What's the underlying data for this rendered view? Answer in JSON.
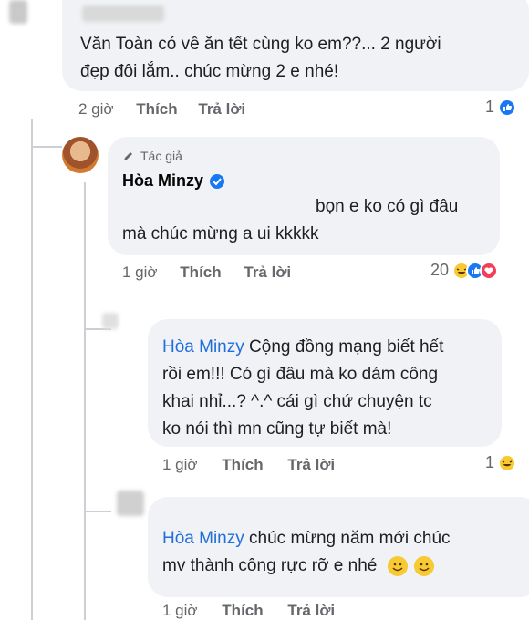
{
  "comments": [
    {
      "text_line1": "Văn Toàn có về ăn tết cùng ko em??... 2 người",
      "text_line2": "đẹp đôi lắm.. chúc mừng 2 e nhé!",
      "time": "2 giờ",
      "like": "Thích",
      "reply": "Trả lời",
      "reaction_count": "1"
    },
    {
      "author_badge": "Tác giả",
      "author": "Hòa Minzy",
      "text_line1": "bọn e ko có gì đâu",
      "text_line2": "mà chúc mừng a ui kkkkk",
      "time": "1 giờ",
      "like": "Thích",
      "reply": "Trả lời",
      "reaction_count": "20"
    },
    {
      "mention": "Hòa Minzy",
      "text_line1": " Cộng đồng mạng biết hết",
      "text_line2": "rồi em!!! Có gì đâu mà ko dám công",
      "text_line3": "khai nhỉ...? ^.^ cái gì chứ chuyện tc",
      "text_line4": "ko nói thì mn cũng tự biết mà!",
      "time": "1 giờ",
      "like": "Thích",
      "reply": "Trả lời",
      "reaction_count": "1"
    },
    {
      "mention": "Hòa Minzy",
      "text_line1": " chúc mừng năm mới chúc",
      "text_line2": "mv thành công rực rỡ e nhé",
      "time": "1 giờ",
      "like": "Thích",
      "reply": "Trả lời"
    }
  ],
  "icons": [
    "pencil-icon",
    "verified-badge-icon",
    "like-reaction-icon",
    "haha-reaction-icon",
    "love-reaction-icon",
    "smile-emoji-icon"
  ],
  "colors": {
    "bubble": "#f0f2f5",
    "mention": "#216fdb",
    "meta": "#65676b",
    "verified": "#1877f2"
  }
}
